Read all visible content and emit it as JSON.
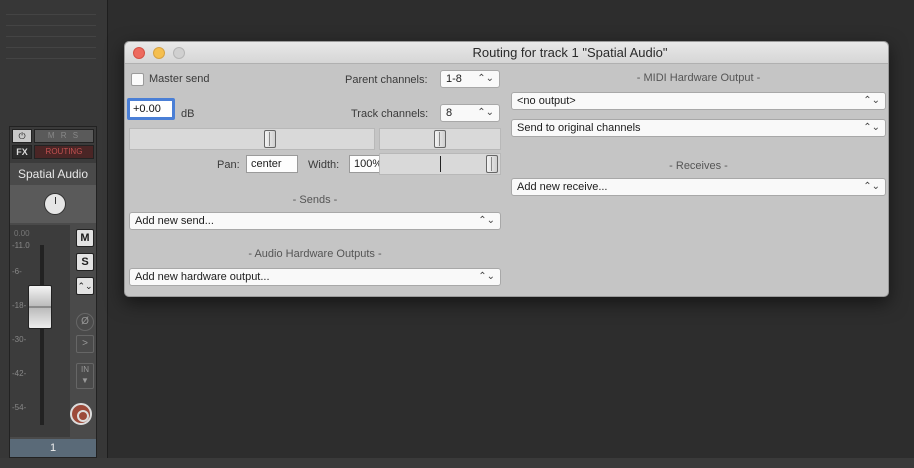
{
  "dialog": {
    "title": "Routing for track 1 \"Spatial Audio\"",
    "master_send_label": "Master send",
    "parent_channels_label": "Parent channels:",
    "parent_channels_value": "1-8",
    "track_channels_label": "Track channels:",
    "track_channels_value": "8",
    "volume_value": "+0.00",
    "volume_unit": "dB",
    "pan_label": "Pan:",
    "pan_value": "center",
    "width_label": "Width:",
    "width_value": "100%",
    "sends_header": "- Sends -",
    "add_send": "Add new send...",
    "audio_hw_header": "- Audio Hardware Outputs -",
    "add_hw_output": "Add new hardware output...",
    "midi_hw_header": "- MIDI Hardware Output -",
    "midi_output_value": "<no output>",
    "midi_channels_value": "Send to original channels",
    "receives_header": "- Receives -",
    "add_receive": "Add new receive..."
  },
  "track_strip": {
    "power_glyph": "⏻",
    "mrs_label": "M R S",
    "fx_label": "FX",
    "routing_label": "ROUTING",
    "track_name": "Spatial Audio",
    "meter_value": "0.00",
    "meter_peak": "-11.0",
    "meter_ticks": [
      "-6-",
      "-18-",
      "-30-",
      "-42-",
      "-54-"
    ],
    "mute_label": "M",
    "solo_label": "S",
    "track_number": "1"
  },
  "icons": {
    "chevron": "up-down-chevron-icon",
    "envelope": "envelope-icon",
    "phase": "phase-icon",
    "fx_bypass": "fx-bypass-icon",
    "input_monitor": "input-monitor-icon",
    "record_arm": "record-arm-icon"
  }
}
